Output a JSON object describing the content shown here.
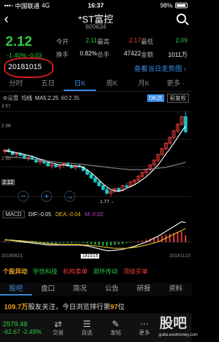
{
  "status": {
    "carrier": "中国联通",
    "network": "4G",
    "time": "16:37",
    "battery": "98%"
  },
  "header": {
    "title": "*ST富控",
    "code": "600634"
  },
  "quote": {
    "price": "2.12",
    "change": "-1.40%  -0.03",
    "rows": [
      [
        {
          "l": "今开",
          "v": "2.11",
          "c": "green"
        },
        {
          "l": "最高",
          "v": "2.17",
          "c": "red"
        },
        {
          "l": "最低",
          "v": "2.09",
          "c": "green"
        }
      ],
      [
        {
          "l": "换手",
          "v": "0.82%",
          "c": "white"
        },
        {
          "l": "总手",
          "v": "47422",
          "c": "white"
        },
        {
          "l": "金额",
          "v": "1011万",
          "c": "white"
        }
      ]
    ],
    "date": "20181015",
    "review_link": "查看当日走势图 ›"
  },
  "period_tabs": [
    "分时",
    "五日",
    "日K",
    "周K",
    "月K",
    "更多 ·"
  ],
  "ma": {
    "settings": "⚙设置",
    "label": "均线",
    "ma5": "MA5:2.25",
    "ma60": "60:2.35",
    "dk": "DK点",
    "fq": "前复权"
  },
  "kchart": {
    "y_labels": [
      "3.57",
      "2.98",
      "2.40",
      "1.77"
    ],
    "price_tag": "2.12",
    "low_mark": "1.77→"
  },
  "macd": {
    "name": "MACD",
    "dif": "DIF:-0.05",
    "dea": "DEA:-0.04",
    "m": "M:-0.02"
  },
  "date_axis": {
    "start": "20180821",
    "mid": "181015",
    "end": "20181123"
  },
  "events": {
    "title": "个股异动",
    "items": [
      "宇信科技",
      "机构卖单",
      "双环传动",
      "顶级买单"
    ]
  },
  "info_tabs": [
    "股吧",
    "盘口",
    "简况",
    "公告",
    "研报",
    "资料"
  ],
  "follow": {
    "count": "109.7万",
    "text1": "股友关注，今日浏览排行第",
    "rank": "97",
    "text2": "位"
  },
  "bottom": {
    "index": {
      "value": "2579.48",
      "change": "-62.67  -2.49%"
    },
    "tools": [
      {
        "g": "⇄",
        "l": "交易"
      },
      {
        "g": "☰",
        "l": "自选"
      },
      {
        "g": "✎",
        "l": "发帖"
      },
      {
        "g": "⋯",
        "l": "更多"
      }
    ],
    "watermark": "股吧",
    "watermark_sub": "guba.eastmoney.com"
  },
  "colors": {
    "up": "#f23d3d",
    "down": "#2ecc40",
    "accent": "#3a8ee6",
    "bg": "#000000"
  },
  "chart_data": {
    "type": "candlestick",
    "ylim": [
      1.5,
      3.7
    ],
    "x_ticks": [
      "20180821",
      "181015",
      "20181123"
    ],
    "candles": [
      [
        2.72,
        2.78,
        2.68,
        2.76
      ],
      [
        2.76,
        2.8,
        2.7,
        2.72
      ],
      [
        2.72,
        2.74,
        2.64,
        2.66
      ],
      [
        2.66,
        2.7,
        2.6,
        2.68
      ],
      [
        2.68,
        2.72,
        2.62,
        2.64
      ],
      [
        2.64,
        2.66,
        2.56,
        2.58
      ],
      [
        2.58,
        2.62,
        2.52,
        2.6
      ],
      [
        2.6,
        2.64,
        2.54,
        2.56
      ],
      [
        2.56,
        2.58,
        2.48,
        2.5
      ],
      [
        2.5,
        2.54,
        2.44,
        2.52
      ],
      [
        2.52,
        2.56,
        2.46,
        2.48
      ],
      [
        2.48,
        2.5,
        2.4,
        2.42
      ],
      [
        2.42,
        2.46,
        2.36,
        2.44
      ],
      [
        2.44,
        2.48,
        2.38,
        2.4
      ],
      [
        2.4,
        2.46,
        2.34,
        2.44
      ],
      [
        2.44,
        2.48,
        2.38,
        2.46
      ],
      [
        2.46,
        2.5,
        2.4,
        2.42
      ],
      [
        2.42,
        2.46,
        2.36,
        2.38
      ],
      [
        2.38,
        2.44,
        2.32,
        2.42
      ],
      [
        2.42,
        2.46,
        2.36,
        2.4
      ],
      [
        2.4,
        2.42,
        2.3,
        2.32
      ],
      [
        2.32,
        2.36,
        2.22,
        2.24
      ],
      [
        2.24,
        2.28,
        2.14,
        2.16
      ],
      [
        2.16,
        2.2,
        2.06,
        2.08
      ],
      [
        2.08,
        2.12,
        1.98,
        2.0
      ],
      [
        2.0,
        2.04,
        1.9,
        1.92
      ],
      [
        1.92,
        1.96,
        1.8,
        1.84
      ],
      [
        1.84,
        1.9,
        1.77,
        1.88
      ],
      [
        1.88,
        1.96,
        1.84,
        1.94
      ],
      [
        1.94,
        1.98,
        1.86,
        1.9
      ],
      [
        1.9,
        2.02,
        1.88,
        2.0
      ],
      [
        2.0,
        2.06,
        1.94,
        1.98
      ],
      [
        1.98,
        2.1,
        1.96,
        2.08
      ],
      [
        2.08,
        2.14,
        2.02,
        2.12
      ],
      [
        2.12,
        2.22,
        2.08,
        2.2
      ],
      [
        2.2,
        2.3,
        2.16,
        2.28
      ],
      [
        2.28,
        2.36,
        2.22,
        2.34
      ],
      [
        2.34,
        2.46,
        2.3,
        2.44
      ],
      [
        2.44,
        2.56,
        2.4,
        2.54
      ],
      [
        2.54,
        2.68,
        2.5,
        2.66
      ],
      [
        2.66,
        2.8,
        2.62,
        2.78
      ],
      [
        2.78,
        2.92,
        2.74,
        2.9
      ],
      [
        2.9,
        3.04,
        2.86,
        3.02
      ],
      [
        3.02,
        3.18,
        2.98,
        3.16
      ],
      [
        3.16,
        3.32,
        3.12,
        3.3
      ],
      [
        3.3,
        3.48,
        3.26,
        3.46
      ],
      [
        3.46,
        3.57,
        3.1,
        3.14
      ]
    ],
    "ma5": [
      2.74,
      2.73,
      2.71,
      2.7,
      2.68,
      2.66,
      2.64,
      2.62,
      2.59,
      2.56,
      2.54,
      2.5,
      2.48,
      2.46,
      2.44,
      2.44,
      2.43,
      2.42,
      2.42,
      2.41,
      2.38,
      2.33,
      2.27,
      2.2,
      2.12,
      2.04,
      1.97,
      1.92,
      1.89,
      1.88,
      1.9,
      1.95,
      1.98,
      2.02,
      2.07,
      2.13,
      2.19,
      2.27,
      2.35,
      2.44,
      2.55,
      2.67,
      2.78,
      2.9,
      3.02,
      3.15,
      3.26
    ],
    "ma60": [
      2.62,
      2.61,
      2.6,
      2.6,
      2.59,
      2.58,
      2.57,
      2.56,
      2.55,
      2.54,
      2.53,
      2.52,
      2.51,
      2.5,
      2.49,
      2.48,
      2.48,
      2.47,
      2.46,
      2.46,
      2.45,
      2.44,
      2.43,
      2.42,
      2.41,
      2.4,
      2.39,
      2.38,
      2.37,
      2.36,
      2.35,
      2.35,
      2.34,
      2.34,
      2.34,
      2.34,
      2.35,
      2.35,
      2.36,
      2.37,
      2.38,
      2.39,
      2.41,
      2.43,
      2.45,
      2.47,
      2.5
    ],
    "macd_hist": [
      0.02,
      0.01,
      0.0,
      -0.01,
      -0.01,
      -0.02,
      -0.02,
      -0.03,
      -0.03,
      -0.03,
      -0.04,
      -0.04,
      -0.03,
      -0.03,
      -0.02,
      -0.02,
      -0.02,
      -0.02,
      -0.01,
      -0.01,
      -0.02,
      -0.03,
      -0.04,
      -0.05,
      -0.06,
      -0.07,
      -0.08,
      -0.07,
      -0.06,
      -0.05,
      -0.04,
      -0.02,
      -0.01,
      0.0,
      0.02,
      0.03,
      0.05,
      0.07,
      0.09,
      0.11,
      0.13,
      0.15,
      0.17,
      0.19,
      0.21,
      0.22,
      0.14
    ],
    "dif": [
      0.05,
      0.04,
      0.03,
      0.02,
      0.01,
      0.0,
      -0.01,
      -0.02,
      -0.03,
      -0.04,
      -0.05,
      -0.06,
      -0.06,
      -0.06,
      -0.06,
      -0.06,
      -0.06,
      -0.06,
      -0.06,
      -0.06,
      -0.07,
      -0.08,
      -0.1,
      -0.12,
      -0.14,
      -0.16,
      -0.18,
      -0.18,
      -0.17,
      -0.16,
      -0.15,
      -0.13,
      -0.11,
      -0.09,
      -0.06,
      -0.03,
      0.0,
      0.04,
      0.08,
      0.12,
      0.17,
      0.22,
      0.27,
      0.32,
      0.37,
      0.42,
      0.4
    ],
    "dea": [
      0.04,
      0.04,
      0.04,
      0.03,
      0.03,
      0.02,
      0.01,
      0.01,
      0.0,
      -0.01,
      -0.02,
      -0.03,
      -0.04,
      -0.04,
      -0.05,
      -0.05,
      -0.05,
      -0.05,
      -0.05,
      -0.05,
      -0.06,
      -0.06,
      -0.07,
      -0.08,
      -0.09,
      -0.1,
      -0.11,
      -0.12,
      -0.13,
      -0.13,
      -0.13,
      -0.13,
      -0.12,
      -0.11,
      -0.1,
      -0.08,
      -0.06,
      -0.04,
      -0.02,
      0.01,
      0.04,
      0.08,
      0.12,
      0.16,
      0.2,
      0.24,
      0.28
    ]
  }
}
